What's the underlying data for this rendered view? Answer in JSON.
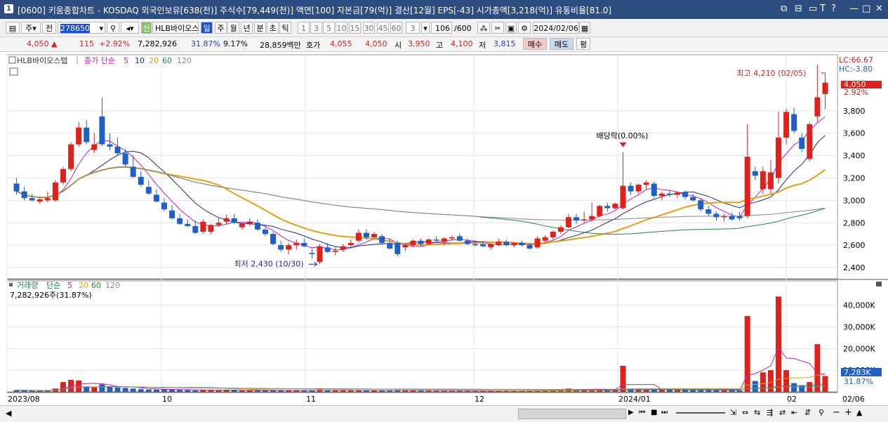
{
  "window": {
    "title": "[0600] 키움종합차트 - KOSDAQ 외국인보유[638(천)] 주식수[79,449(천)] 액면[100] 자본금[79(억)] 결산[12월] EPS[-43] 시가총액[3,218(억)] 유통비율[81.0]",
    "index": "1"
  },
  "toolbar": {
    "period_mode": "주",
    "all_label": "전",
    "stock_code": "278650",
    "new_label": "신",
    "stock_name": "HLB바이오스",
    "period_tabs": [
      "일",
      "주",
      "월",
      "년",
      "분",
      "초",
      "틱"
    ],
    "active_period": "일",
    "intervals": [
      "1",
      "3",
      "5",
      "10",
      "15",
      "30",
      "45",
      "60",
      "3"
    ],
    "count": "106",
    "count_total": "/600",
    "date": "2024/02/06"
  },
  "quote": {
    "price": "4,050",
    "arrow": "▲",
    "change": "115",
    "change_pct": "+2.92%",
    "volume": "7,282,926",
    "vol_ratio": "31.87%",
    "turnover": "9.17%",
    "amount": "28,859백만",
    "ask_label": "호가",
    "ask": "4,055",
    "bid": "4,050",
    "open_label": "시",
    "open": "3,950",
    "high_label": "고",
    "high": "4,100",
    "low_label": "저",
    "low": "3,815",
    "buy_label": "매수",
    "sell_label": "매도",
    "avg_label": "평"
  },
  "price_panel": {
    "stock_label": "HLB바이오스텝",
    "ma_title": "종가 단순",
    "ma_periods": [
      "5",
      "10",
      "20",
      "60",
      "120"
    ],
    "lc": "LC:66.67",
    "hc": "HC:-3.80",
    "current_price": "4,050",
    "current_pct": "2.92%",
    "y_ticks": [
      "3,800",
      "3,600",
      "3,400",
      "3,200",
      "3,000",
      "2,800",
      "2,600",
      "2,400"
    ],
    "high_annotation": "최고 4,210 (02/05)",
    "low_annotation": "최저 2,430 (10/30)",
    "dividend_annotation": "배당락(0.00%)"
  },
  "volume_panel": {
    "title": "거래량",
    "ma_title": "단순",
    "ma_periods": [
      "5",
      "20",
      "60",
      "120"
    ],
    "volume_text": "7,282,926주(31.87%)",
    "y_ticks": [
      "40,000K",
      "30,000K",
      "20,000K",
      "10,000K"
    ],
    "current_volume": "7,283K",
    "current_pct": "31.87%"
  },
  "x_axis": {
    "labels": [
      "2023/08",
      "10",
      "11",
      "12",
      "2024/01",
      "02"
    ],
    "right_label": "02/06"
  },
  "colors": {
    "up": "#e0201a",
    "down": "#1f5fc8",
    "ma5": "#c020c0",
    "ma10": "#1a2a8c",
    "ma20": "#e8a010",
    "ma60": "#1c8c3c",
    "ma120": "#888888",
    "titlebar": "#2d4c80"
  },
  "chart_data": {
    "type": "candlestick",
    "candles": [
      {
        "o": 3150,
        "h": 3200,
        "l": 3050,
        "c": 3080,
        "v": 800
      },
      {
        "o": 3080,
        "h": 3120,
        "l": 3000,
        "c": 3020,
        "v": 600
      },
      {
        "o": 3020,
        "h": 3060,
        "l": 2990,
        "c": 3000,
        "v": 500
      },
      {
        "o": 2990,
        "h": 3030,
        "l": 2970,
        "c": 3010,
        "v": 550
      },
      {
        "o": 3000,
        "h": 3080,
        "l": 2980,
        "c": 3020,
        "v": 700
      },
      {
        "o": 3000,
        "h": 3180,
        "l": 2990,
        "c": 3160,
        "v": 1500
      },
      {
        "o": 3160,
        "h": 3300,
        "l": 3140,
        "c": 3280,
        "v": 4500
      },
      {
        "o": 3280,
        "h": 3520,
        "l": 3260,
        "c": 3500,
        "v": 5500
      },
      {
        "o": 3500,
        "h": 3700,
        "l": 3480,
        "c": 3650,
        "v": 5200
      },
      {
        "o": 3650,
        "h": 3720,
        "l": 3500,
        "c": 3520,
        "v": 2500
      },
      {
        "o": 3450,
        "h": 3600,
        "l": 3420,
        "c": 3500,
        "v": 2000
      },
      {
        "o": 3750,
        "h": 3920,
        "l": 3480,
        "c": 3500,
        "v": 3500
      },
      {
        "o": 3500,
        "h": 3600,
        "l": 3450,
        "c": 3480,
        "v": 2500
      },
      {
        "o": 3480,
        "h": 3560,
        "l": 3400,
        "c": 3420,
        "v": 2000
      },
      {
        "o": 3420,
        "h": 3460,
        "l": 3300,
        "c": 3320,
        "v": 1800
      },
      {
        "o": 3300,
        "h": 3400,
        "l": 3200,
        "c": 3210,
        "v": 1500
      },
      {
        "o": 3210,
        "h": 3260,
        "l": 3120,
        "c": 3140,
        "v": 1200
      },
      {
        "o": 3120,
        "h": 3180,
        "l": 3050,
        "c": 3060,
        "v": 1100
      },
      {
        "o": 3050,
        "h": 3100,
        "l": 2980,
        "c": 2990,
        "v": 1000
      },
      {
        "o": 2980,
        "h": 3020,
        "l": 2900,
        "c": 2920,
        "v": 1200
      },
      {
        "o": 2910,
        "h": 2960,
        "l": 2830,
        "c": 2840,
        "v": 1100
      },
      {
        "o": 2840,
        "h": 2880,
        "l": 2780,
        "c": 2790,
        "v": 900
      },
      {
        "o": 2790,
        "h": 2830,
        "l": 2760,
        "c": 2770,
        "v": 800
      },
      {
        "o": 2770,
        "h": 2820,
        "l": 2700,
        "c": 2710,
        "v": 700
      },
      {
        "o": 2720,
        "h": 2830,
        "l": 2700,
        "c": 2810,
        "v": 900
      },
      {
        "o": 2720,
        "h": 2790,
        "l": 2700,
        "c": 2780,
        "v": 800
      },
      {
        "o": 2780,
        "h": 2840,
        "l": 2760,
        "c": 2800,
        "v": 700
      },
      {
        "o": 2810,
        "h": 2870,
        "l": 2790,
        "c": 2840,
        "v": 900
      },
      {
        "o": 2840,
        "h": 2880,
        "l": 2790,
        "c": 2800,
        "v": 800
      },
      {
        "o": 2760,
        "h": 2800,
        "l": 2740,
        "c": 2790,
        "v": 600
      },
      {
        "o": 2790,
        "h": 2840,
        "l": 2770,
        "c": 2810,
        "v": 700
      },
      {
        "o": 2800,
        "h": 2830,
        "l": 2730,
        "c": 2740,
        "v": 700
      },
      {
        "o": 2740,
        "h": 2780,
        "l": 2680,
        "c": 2700,
        "v": 650
      },
      {
        "o": 2700,
        "h": 2720,
        "l": 2600,
        "c": 2610,
        "v": 700
      },
      {
        "o": 2600,
        "h": 2640,
        "l": 2540,
        "c": 2560,
        "v": 800
      },
      {
        "o": 2560,
        "h": 2620,
        "l": 2520,
        "c": 2600,
        "v": 700
      },
      {
        "o": 2600,
        "h": 2650,
        "l": 2560,
        "c": 2620,
        "v": 650
      },
      {
        "o": 2620,
        "h": 2660,
        "l": 2580,
        "c": 2590,
        "v": 600
      },
      {
        "o": 2530,
        "h": 2570,
        "l": 2480,
        "c": 2520,
        "v": 800
      },
      {
        "o": 2450,
        "h": 2610,
        "l": 2430,
        "c": 2590,
        "v": 1200
      },
      {
        "o": 2580,
        "h": 2620,
        "l": 2530,
        "c": 2540,
        "v": 900
      },
      {
        "o": 2540,
        "h": 2580,
        "l": 2510,
        "c": 2550,
        "v": 700
      },
      {
        "o": 2560,
        "h": 2610,
        "l": 2540,
        "c": 2590,
        "v": 700
      },
      {
        "o": 2600,
        "h": 2650,
        "l": 2570,
        "c": 2620,
        "v": 750
      },
      {
        "o": 2640,
        "h": 2740,
        "l": 2620,
        "c": 2710,
        "v": 900
      },
      {
        "o": 2710,
        "h": 2740,
        "l": 2650,
        "c": 2670,
        "v": 800
      },
      {
        "o": 2670,
        "h": 2720,
        "l": 2650,
        "c": 2700,
        "v": 750
      },
      {
        "o": 2680,
        "h": 2700,
        "l": 2600,
        "c": 2620,
        "v": 700
      },
      {
        "o": 2620,
        "h": 2660,
        "l": 2560,
        "c": 2570,
        "v": 800
      },
      {
        "o": 2620,
        "h": 2640,
        "l": 2500,
        "c": 2520,
        "v": 900
      },
      {
        "o": 2580,
        "h": 2620,
        "l": 2550,
        "c": 2600,
        "v": 700
      },
      {
        "o": 2600,
        "h": 2650,
        "l": 2580,
        "c": 2640,
        "v": 650
      },
      {
        "o": 2640,
        "h": 2660,
        "l": 2590,
        "c": 2610,
        "v": 600
      },
      {
        "o": 2610,
        "h": 2660,
        "l": 2600,
        "c": 2650,
        "v": 600
      },
      {
        "o": 2650,
        "h": 2680,
        "l": 2620,
        "c": 2640,
        "v": 550
      },
      {
        "o": 2630,
        "h": 2670,
        "l": 2600,
        "c": 2660,
        "v": 550
      },
      {
        "o": 2660,
        "h": 2690,
        "l": 2640,
        "c": 2670,
        "v": 500
      },
      {
        "o": 2680,
        "h": 2700,
        "l": 2630,
        "c": 2640,
        "v": 500
      },
      {
        "o": 2640,
        "h": 2660,
        "l": 2600,
        "c": 2610,
        "v": 450
      },
      {
        "o": 2610,
        "h": 2630,
        "l": 2590,
        "c": 2600,
        "v": 450
      },
      {
        "o": 2610,
        "h": 2630,
        "l": 2580,
        "c": 2590,
        "v": 450
      },
      {
        "o": 2580,
        "h": 2620,
        "l": 2560,
        "c": 2610,
        "v": 500
      },
      {
        "o": 2600,
        "h": 2660,
        "l": 2590,
        "c": 2630,
        "v": 500
      },
      {
        "o": 2630,
        "h": 2650,
        "l": 2590,
        "c": 2600,
        "v": 450
      },
      {
        "o": 2600,
        "h": 2630,
        "l": 2580,
        "c": 2620,
        "v": 450
      },
      {
        "o": 2620,
        "h": 2640,
        "l": 2590,
        "c": 2600,
        "v": 450
      },
      {
        "o": 2600,
        "h": 2620,
        "l": 2560,
        "c": 2570,
        "v": 500
      },
      {
        "o": 2580,
        "h": 2680,
        "l": 2570,
        "c": 2660,
        "v": 600
      },
      {
        "o": 2640,
        "h": 2690,
        "l": 2620,
        "c": 2670,
        "v": 650
      },
      {
        "o": 2670,
        "h": 2730,
        "l": 2650,
        "c": 2720,
        "v": 700
      },
      {
        "o": 2720,
        "h": 2780,
        "l": 2700,
        "c": 2760,
        "v": 900
      },
      {
        "o": 2760,
        "h": 2880,
        "l": 2750,
        "c": 2850,
        "v": 1500
      },
      {
        "o": 2850,
        "h": 2880,
        "l": 2790,
        "c": 2820,
        "v": 1200
      },
      {
        "o": 2820,
        "h": 2900,
        "l": 2800,
        "c": 2830,
        "v": 1000
      },
      {
        "o": 2830,
        "h": 2980,
        "l": 2810,
        "c": 2860,
        "v": 1300
      },
      {
        "o": 2860,
        "h": 2960,
        "l": 2850,
        "c": 2950,
        "v": 1200
      },
      {
        "o": 2950,
        "h": 2980,
        "l": 2900,
        "c": 2930,
        "v": 1100
      },
      {
        "o": 2930,
        "h": 2980,
        "l": 2920,
        "c": 2970,
        "v": 1000
      },
      {
        "o": 2930,
        "h": 3430,
        "l": 2920,
        "c": 3130,
        "v": 12000
      },
      {
        "o": 3130,
        "h": 3160,
        "l": 3050,
        "c": 3080,
        "v": 1500
      },
      {
        "o": 3080,
        "h": 3150,
        "l": 3060,
        "c": 3140,
        "v": 1200
      },
      {
        "o": 3140,
        "h": 3180,
        "l": 3100,
        "c": 3160,
        "v": 1100
      },
      {
        "o": 3150,
        "h": 3170,
        "l": 3020,
        "c": 3040,
        "v": 1000
      },
      {
        "o": 3040,
        "h": 3080,
        "l": 3000,
        "c": 3060,
        "v": 900
      },
      {
        "o": 3060,
        "h": 3090,
        "l": 3030,
        "c": 3050,
        "v": 850
      },
      {
        "o": 3050,
        "h": 3080,
        "l": 3020,
        "c": 3070,
        "v": 800
      },
      {
        "o": 3070,
        "h": 3090,
        "l": 3010,
        "c": 3030,
        "v": 900
      },
      {
        "o": 3030,
        "h": 3060,
        "l": 2990,
        "c": 3000,
        "v": 850
      },
      {
        "o": 3000,
        "h": 3020,
        "l": 2900,
        "c": 2920,
        "v": 900
      },
      {
        "o": 2920,
        "h": 2950,
        "l": 2860,
        "c": 2880,
        "v": 850
      },
      {
        "o": 2880,
        "h": 2900,
        "l": 2820,
        "c": 2850,
        "v": 800
      },
      {
        "o": 2850,
        "h": 2880,
        "l": 2810,
        "c": 2860,
        "v": 700
      },
      {
        "o": 2860,
        "h": 2890,
        "l": 2820,
        "c": 2830,
        "v": 700
      },
      {
        "o": 2860,
        "h": 2900,
        "l": 2820,
        "c": 2840,
        "v": 700
      },
      {
        "o": 2860,
        "h": 3680,
        "l": 2840,
        "c": 3390,
        "v": 35000
      },
      {
        "o": 3260,
        "h": 3300,
        "l": 3180,
        "c": 3220,
        "v": 5000
      },
      {
        "o": 3100,
        "h": 3300,
        "l": 3060,
        "c": 3260,
        "v": 9000
      },
      {
        "o": 3100,
        "h": 3360,
        "l": 3060,
        "c": 3250,
        "v": 10000
      },
      {
        "o": 3200,
        "h": 3790,
        "l": 3150,
        "c": 3560,
        "v": 44000
      },
      {
        "o": 3560,
        "h": 3820,
        "l": 3500,
        "c": 3790,
        "v": 10000
      },
      {
        "o": 3770,
        "h": 3830,
        "l": 3600,
        "c": 3620,
        "v": 4000
      },
      {
        "o": 3560,
        "h": 3600,
        "l": 3430,
        "c": 3460,
        "v": 3000
      },
      {
        "o": 3370,
        "h": 3700,
        "l": 3350,
        "c": 3680,
        "v": 4500
      },
      {
        "o": 3750,
        "h": 4210,
        "l": 3700,
        "c": 3920,
        "v": 22000
      },
      {
        "o": 3950,
        "h": 4100,
        "l": 3815,
        "c": 4050,
        "v": 7283
      }
    ],
    "ma_periods": [
      5,
      10,
      20,
      60,
      120
    ],
    "price_range": [
      2300,
      4300
    ],
    "volume_range": [
      0,
      48000
    ],
    "volume_unit": "K"
  }
}
